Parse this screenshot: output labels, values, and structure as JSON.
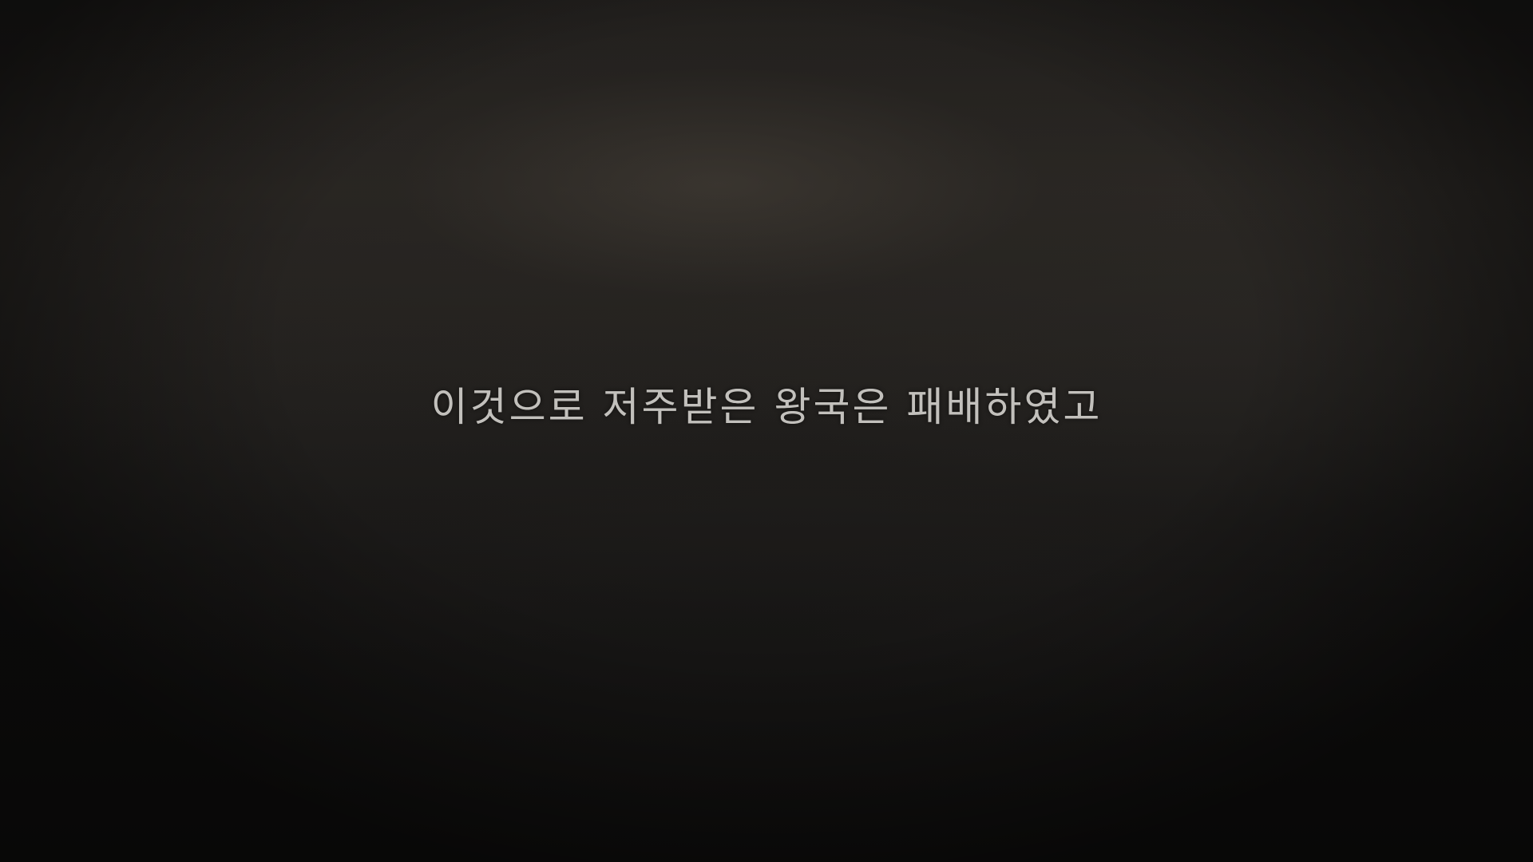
{
  "scene": {
    "subtitle": "이것으로 저주받은 왕국은 패배하였고"
  },
  "colors": {
    "background": "#121110",
    "subtitle_text": "#d4d2ce"
  }
}
